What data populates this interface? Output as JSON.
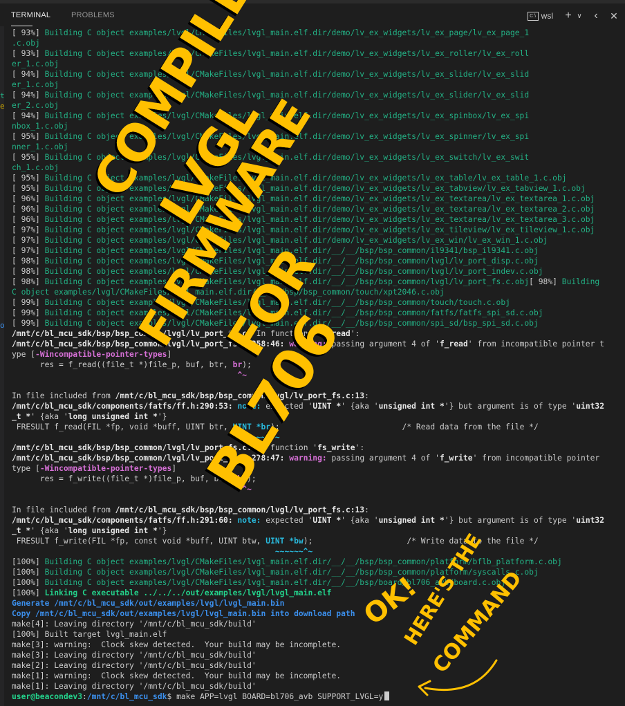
{
  "panel": {
    "tabs": [
      {
        "label": "TERMINAL",
        "active": true
      },
      {
        "label": "PROBLEMS",
        "active": false
      }
    ],
    "shell_icon_text": "C:\\",
    "shell_label": "wsl",
    "icons": [
      "terminal-shell-icon",
      "plus-icon",
      "chevron-down-icon",
      "chevron-left-icon",
      "close-icon"
    ]
  },
  "colors": {
    "background": "#1e1e1e",
    "green": "#23b185",
    "magenta": "#d670d6",
    "cyan": "#29b8db",
    "blue": "#3b8eea",
    "annotation": "#ffc000"
  },
  "terminal": {
    "lines": [
      [
        {
          "t": "[ 93%] ",
          "c": "w"
        },
        {
          "t": "Building C object examples/lvgl/CMakeFiles/lvgl_main.elf.dir/demo/lv_ex_widgets/lv_ex_page/lv_ex_page_1",
          "c": "g"
        }
      ],
      [
        {
          "t": ".c.obj",
          "c": "g"
        }
      ],
      [
        {
          "t": "[ 93%] ",
          "c": "w"
        },
        {
          "t": "Building C object examples/lvgl/CMakeFiles/lvgl_main.elf.dir/demo/lv_ex_widgets/lv_ex_roller/lv_ex_roll",
          "c": "g"
        }
      ],
      [
        {
          "t": "er_1.c.obj",
          "c": "g"
        }
      ],
      [
        {
          "t": "[ 94%] ",
          "c": "w"
        },
        {
          "t": "Building C object examples/lvgl/CMakeFiles/lvgl_main.elf.dir/demo/lv_ex_widgets/lv_ex_slider/lv_ex_slid",
          "c": "g"
        }
      ],
      [
        {
          "t": "er_1.c.obj",
          "c": "g"
        }
      ],
      [
        {
          "t": "[ 94%] ",
          "c": "w"
        },
        {
          "t": "Building C object examples/lvgl/CMakeFiles/lvgl_main.elf.dir/demo/lv_ex_widgets/lv_ex_slider/lv_ex_slid",
          "c": "g"
        }
      ],
      [
        {
          "t": "er_2.c.obj",
          "c": "g"
        }
      ],
      [
        {
          "t": "[ 94%] ",
          "c": "w"
        },
        {
          "t": "Building C object examples/lvgl/CMakeFiles/lvgl_main.elf.dir/demo/lv_ex_widgets/lv_ex_spinbox/lv_ex_spi",
          "c": "g"
        }
      ],
      [
        {
          "t": "nbox_1.c.obj",
          "c": "g"
        }
      ],
      [
        {
          "t": "[ 95%] ",
          "c": "w"
        },
        {
          "t": "Building C object examples/lvgl/CMakeFiles/lvgl_main.elf.dir/demo/lv_ex_widgets/lv_ex_spinner/lv_ex_spi",
          "c": "g"
        }
      ],
      [
        {
          "t": "nner_1.c.obj",
          "c": "g"
        }
      ],
      [
        {
          "t": "[ 95%] ",
          "c": "w"
        },
        {
          "t": "Building C object examples/lvgl/CMakeFiles/lvgl_main.elf.dir/demo/lv_ex_widgets/lv_ex_switch/lv_ex_swit",
          "c": "g"
        }
      ],
      [
        {
          "t": "ch_1.c.obj",
          "c": "g"
        }
      ],
      [
        {
          "t": "[ 95%] ",
          "c": "w"
        },
        {
          "t": "Building C object examples/lvgl/CMakeFiles/lvgl_main.elf.dir/demo/lv_ex_widgets/lv_ex_table/lv_ex_table_1.c.obj",
          "c": "g"
        }
      ],
      [
        {
          "t": "[ 95%] ",
          "c": "w"
        },
        {
          "t": "Building C object examples/lvgl/CMakeFiles/lvgl_main.elf.dir/demo/lv_ex_widgets/lv_ex_tabview/lv_ex_tabview_1.c.obj",
          "c": "g"
        }
      ],
      [
        {
          "t": "[ 96%] ",
          "c": "w"
        },
        {
          "t": "Building C object examples/lvgl/CMakeFiles/lvgl_main.elf.dir/demo/lv_ex_widgets/lv_ex_textarea/lv_ex_textarea_1.c.obj",
          "c": "g"
        }
      ],
      [
        {
          "t": "[ 96%] ",
          "c": "w"
        },
        {
          "t": "Building C object examples/lvgl/CMakeFiles/lvgl_main.elf.dir/demo/lv_ex_widgets/lv_ex_textarea/lv_ex_textarea_2.c.obj",
          "c": "g"
        }
      ],
      [
        {
          "t": "[ 96%] ",
          "c": "w"
        },
        {
          "t": "Building C object examples/lvgl/CMakeFiles/lvgl_main.elf.dir/demo/lv_ex_widgets/lv_ex_textarea/lv_ex_textarea_3.c.obj",
          "c": "g"
        }
      ],
      [
        {
          "t": "[ 97%] ",
          "c": "w"
        },
        {
          "t": "Building C object examples/lvgl/CMakeFiles/lvgl_main.elf.dir/demo/lv_ex_widgets/lv_ex_tileview/lv_ex_tileview_1.c.obj",
          "c": "g"
        }
      ],
      [
        {
          "t": "[ 97%] ",
          "c": "w"
        },
        {
          "t": "Building C object examples/lvgl/CMakeFiles/lvgl_main.elf.dir/demo/lv_ex_widgets/lv_ex_win/lv_ex_win_1.c.obj",
          "c": "g"
        }
      ],
      [
        {
          "t": "[ 97%] ",
          "c": "w"
        },
        {
          "t": "Building C object examples/lvgl/CMakeFiles/lvgl_main.elf.dir/__/__/bsp/bsp_common/il9341/bsp_il9341.c.obj",
          "c": "g"
        }
      ],
      [
        {
          "t": "[ 98%] ",
          "c": "w"
        },
        {
          "t": "Building C object examples/lvgl/CMakeFiles/lvgl_main.elf.dir/__/__/bsp/bsp_common/lvgl/lv_port_disp.c.obj",
          "c": "g"
        }
      ],
      [
        {
          "t": "[ 98%] ",
          "c": "w"
        },
        {
          "t": "Building C object examples/lvgl/CMakeFiles/lvgl_main.elf.dir/__/__/bsp/bsp_common/lvgl/lv_port_indev.c.obj",
          "c": "g"
        }
      ],
      [
        {
          "t": "[ 98%] ",
          "c": "w"
        },
        {
          "t": "Building C object examples/lvgl/CMakeFiles/lvgl_main.elf.dir/__/__/bsp/bsp_common/lvgl/lv_port_fs.c.obj",
          "c": "g"
        },
        {
          "t": "[ 98%] ",
          "c": "w"
        },
        {
          "t": "Building",
          "c": "g"
        }
      ],
      [
        {
          "t": "C object examples/lvgl/CMakeFiles/lvgl_main.elf.dir/__/__/bsp/bsp_common/touch/xpt2046.c.obj",
          "c": "g"
        }
      ],
      [
        {
          "t": "[ 99%] ",
          "c": "w"
        },
        {
          "t": "Building C object examples/lvgl/CMakeFiles/lvgl_main.elf.dir/__/__/bsp/bsp_common/touch/touch.c.obj",
          "c": "g"
        }
      ],
      [
        {
          "t": "[ 99%] ",
          "c": "w"
        },
        {
          "t": "Building C object examples/lvgl/CMakeFiles/lvgl_main.elf.dir/__/__/bsp/bsp_common/fatfs/fatfs_spi_sd.c.obj",
          "c": "g"
        }
      ],
      [
        {
          "t": "[ 99%] ",
          "c": "w"
        },
        {
          "t": "Building C object examples/lvgl/CMakeFiles/lvgl_main.elf.dir/__/__/bsp/bsp_common/spi_sd/bsp_spi_sd.c.obj",
          "c": "g"
        }
      ],
      [
        {
          "t": "/mnt/c/bl_mcu_sdk/bsp/bsp_common/lvgl/lv_port_fs.c:",
          "c": "b"
        },
        {
          "t": " In function '",
          "c": "w"
        },
        {
          "t": "fs_read",
          "c": "b"
        },
        {
          "t": "':",
          "c": "w"
        }
      ],
      [
        {
          "t": "/mnt/c/bl_mcu_sdk/bsp/bsp_common/lvgl/lv_port_fs.c:258:46:",
          "c": "b"
        },
        {
          "t": " ",
          "c": "w"
        },
        {
          "t": "warning:",
          "c": "m"
        },
        {
          "t": " passing argument 4 of '",
          "c": "w"
        },
        {
          "t": "f_read",
          "c": "b"
        },
        {
          "t": "' from incompatible pointer t",
          "c": "w"
        }
      ],
      [
        {
          "t": "ype [",
          "c": "w"
        },
        {
          "t": "-Wincompatible-pointer-types",
          "c": "m"
        },
        {
          "t": "]",
          "c": "w"
        }
      ],
      [
        {
          "t": "      res = f_read((file_t *)file_p, buf, btr, ",
          "c": "w"
        },
        {
          "t": "br",
          "c": "m"
        },
        {
          "t": ");",
          "c": "w"
        }
      ],
      [
        {
          "t": "                                                ^~",
          "c": "m"
        }
      ],
      [
        {
          "t": "",
          "c": "w"
        }
      ],
      [
        {
          "t": "In file included from ",
          "c": "w"
        },
        {
          "t": "/mnt/c/bl_mcu_sdk/bsp/bsp_common/lvgl/lv_port_fs.c:13",
          "c": "b"
        },
        {
          "t": ":",
          "c": "w"
        }
      ],
      [
        {
          "t": "/mnt/c/bl_mcu_sdk/components/fatfs/ff.h:290:53:",
          "c": "b"
        },
        {
          "t": " ",
          "c": "w"
        },
        {
          "t": "note:",
          "c": "c"
        },
        {
          "t": " expected '",
          "c": "w"
        },
        {
          "t": "UINT *",
          "c": "b"
        },
        {
          "t": "' {aka '",
          "c": "w"
        },
        {
          "t": "unsigned int *",
          "c": "b"
        },
        {
          "t": "'} but argument is of type '",
          "c": "w"
        },
        {
          "t": "uint32",
          "c": "b"
        }
      ],
      [
        {
          "t": "_t *",
          "c": "b"
        },
        {
          "t": "' {aka '",
          "c": "w"
        },
        {
          "t": "long unsigned int *",
          "c": "b"
        },
        {
          "t": "'}",
          "c": "w"
        }
      ],
      [
        {
          "t": " FRESULT f_read(FIL *fp, void *buff, UINT btr, ",
          "c": "w"
        },
        {
          "t": "UINT *br",
          "c": "c"
        },
        {
          "t": ");                          /* Read data from the file */",
          "c": "w"
        }
      ],
      [
        {
          "t": "                                                 ~~~~~~^~",
          "c": "c"
        }
      ],
      [
        {
          "t": "/mnt/c/bl_mcu_sdk/bsp/bsp_common/lvgl/lv_port_fs.c:",
          "c": "b"
        },
        {
          "t": " In function '",
          "c": "w"
        },
        {
          "t": "fs_write",
          "c": "b"
        },
        {
          "t": "':",
          "c": "w"
        }
      ],
      [
        {
          "t": "/mnt/c/bl_mcu_sdk/bsp/bsp_common/lvgl/lv_port_fs.c:278:47:",
          "c": "b"
        },
        {
          "t": " ",
          "c": "w"
        },
        {
          "t": "warning:",
          "c": "m"
        },
        {
          "t": " passing argument 4 of '",
          "c": "w"
        },
        {
          "t": "f_write",
          "c": "b"
        },
        {
          "t": "' from incompatible pointer",
          "c": "w"
        }
      ],
      [
        {
          "t": "type [",
          "c": "w"
        },
        {
          "t": "-Wincompatible-pointer-types",
          "c": "m"
        },
        {
          "t": "]",
          "c": "w"
        }
      ],
      [
        {
          "t": "      res = f_write((file_t *)file_p, buf, btw, ",
          "c": "w"
        },
        {
          "t": "bw",
          "c": "m"
        },
        {
          "t": ");",
          "c": "w"
        }
      ],
      [
        {
          "t": "                                                 ^~",
          "c": "m"
        }
      ],
      [
        {
          "t": "",
          "c": "w"
        }
      ],
      [
        {
          "t": "In file included from ",
          "c": "w"
        },
        {
          "t": "/mnt/c/bl_mcu_sdk/bsp/bsp_common/lvgl/lv_port_fs.c:13",
          "c": "b"
        },
        {
          "t": ":",
          "c": "w"
        }
      ],
      [
        {
          "t": "/mnt/c/bl_mcu_sdk/components/fatfs/ff.h:291:60:",
          "c": "b"
        },
        {
          "t": " ",
          "c": "w"
        },
        {
          "t": "note:",
          "c": "c"
        },
        {
          "t": " expected '",
          "c": "w"
        },
        {
          "t": "UINT *",
          "c": "b"
        },
        {
          "t": "' {aka '",
          "c": "w"
        },
        {
          "t": "unsigned int *",
          "c": "b"
        },
        {
          "t": "'} but argument is of type '",
          "c": "w"
        },
        {
          "t": "uint32",
          "c": "b"
        }
      ],
      [
        {
          "t": "_t *",
          "c": "b"
        },
        {
          "t": "' {aka '",
          "c": "w"
        },
        {
          "t": "long unsigned int *",
          "c": "b"
        },
        {
          "t": "'}",
          "c": "w"
        }
      ],
      [
        {
          "t": " FRESULT f_write(FIL *fp, const void *buff, UINT btw, ",
          "c": "w"
        },
        {
          "t": "UINT *bw",
          "c": "c"
        },
        {
          "t": ");                    /* Write data to the file */",
          "c": "w"
        }
      ],
      [
        {
          "t": "                                                        ~~~~~~^~",
          "c": "c"
        }
      ],
      [
        {
          "t": "[100%] ",
          "c": "w"
        },
        {
          "t": "Building C object examples/lvgl/CMakeFiles/lvgl_main.elf.dir/__/__/bsp/bsp_common/platform/bflb_platform.c.obj",
          "c": "g"
        }
      ],
      [
        {
          "t": "[100%] ",
          "c": "w"
        },
        {
          "t": "Building C object examples/lvgl/CMakeFiles/lvgl_main.elf.dir/__/__/bsp/bsp_common/platform/syscalls.c.obj",
          "c": "g"
        }
      ],
      [
        {
          "t": "[100%] ",
          "c": "w"
        },
        {
          "t": "Building C object examples/lvgl/CMakeFiles/lvgl_main.elf.dir/__/__/bsp/board/bl706_avb/board.c.obj",
          "c": "g"
        }
      ],
      [
        {
          "t": "[100%] ",
          "c": "w"
        },
        {
          "t": "Linking C executable ../../../out/examples/lvgl/lvgl_main.elf",
          "c": "gb"
        }
      ],
      [
        {
          "t": "Generate /mnt/c/bl_mcu_sdk/out/examples/lvgl/lvgl_main.bin",
          "c": "blue"
        }
      ],
      [
        {
          "t": "Copy /mnt/c/bl_mcu_sdk/out/examples/lvgl/lvgl_main.bin into download path",
          "c": "blue"
        }
      ],
      [
        {
          "t": "make[4]: Leaving directory '/mnt/c/bl_mcu_sdk/build'",
          "c": "w"
        }
      ],
      [
        {
          "t": "[100%] Built target lvgl_main.elf",
          "c": "w"
        }
      ],
      [
        {
          "t": "make[3]: warning:  Clock skew detected.  Your build may be incomplete.",
          "c": "w"
        }
      ],
      [
        {
          "t": "make[3]: Leaving directory '/mnt/c/bl_mcu_sdk/build'",
          "c": "w"
        }
      ],
      [
        {
          "t": "make[2]: Leaving directory '/mnt/c/bl_mcu_sdk/build'",
          "c": "w"
        }
      ],
      [
        {
          "t": "make[1]: warning:  Clock skew detected.  Your build may be incomplete.",
          "c": "w"
        }
      ],
      [
        {
          "t": "make[1]: Leaving directory '/mnt/c/bl_mcu_sdk/build'",
          "c": "w"
        }
      ]
    ],
    "prompt": {
      "user_host": "user@beacondev3",
      "separator": ":",
      "path": "/mnt/c/bl_mcu_sdk",
      "symbol": "$",
      "command": " make APP=lvgl BOARD=bl706_avb SUPPORT_LVGL=y"
    }
  },
  "annotations": {
    "main_lines": [
      "COMPILE",
      "LVGL",
      "FIRMWARE",
      "FOR",
      "BL706"
    ],
    "side_lines": [
      "OK!",
      "HERE'S THE",
      "COMMAND"
    ]
  }
}
